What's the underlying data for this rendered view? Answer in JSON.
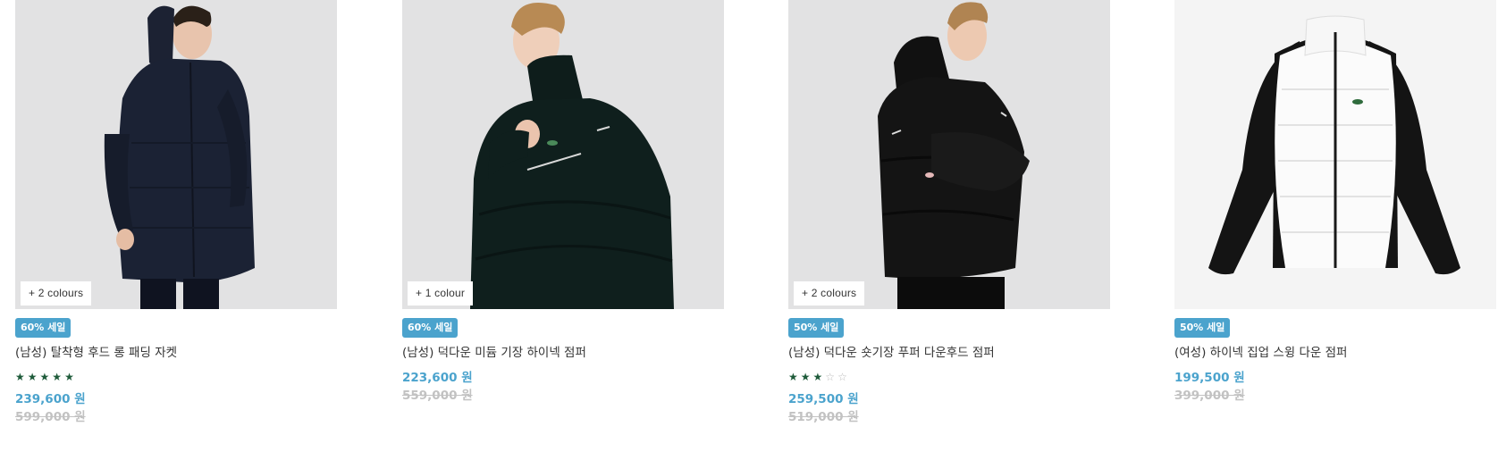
{
  "products": [
    {
      "colours": "+ 2 colours",
      "badge": "60% 세일",
      "name": "(남성) 탈착형 후드 롱 패딩 자켓",
      "rating": 5,
      "price": "239,600 원",
      "original_price": "599,000 원"
    },
    {
      "colours": "+ 1 colour",
      "badge": "60% 세일",
      "name": "(남성) 덕다운 미듐 기장 하이넥 점퍼",
      "rating": null,
      "price": "223,600 원",
      "original_price": "559,000 원"
    },
    {
      "colours": "+ 2 colours",
      "badge": "50% 세일",
      "name": "(남성) 덕다운 숏기장 푸퍼 다운후드 점퍼",
      "rating": 3,
      "price": "259,500 원",
      "original_price": "519,000 원"
    },
    {
      "colours": null,
      "badge": "50% 세일",
      "name": "(여성) 하이넥 집업 스윙 다운 점퍼",
      "rating": null,
      "price": "199,500 원",
      "original_price": "399,000 원"
    }
  ],
  "colors": {
    "badge_bg": "#4ba3cd",
    "price": "#4ba3cd",
    "original_price": "#c2c2c2",
    "star_filled": "#1e5b3a",
    "star_empty": "#bbbbbb",
    "image_bg": "#e2e2e3"
  }
}
